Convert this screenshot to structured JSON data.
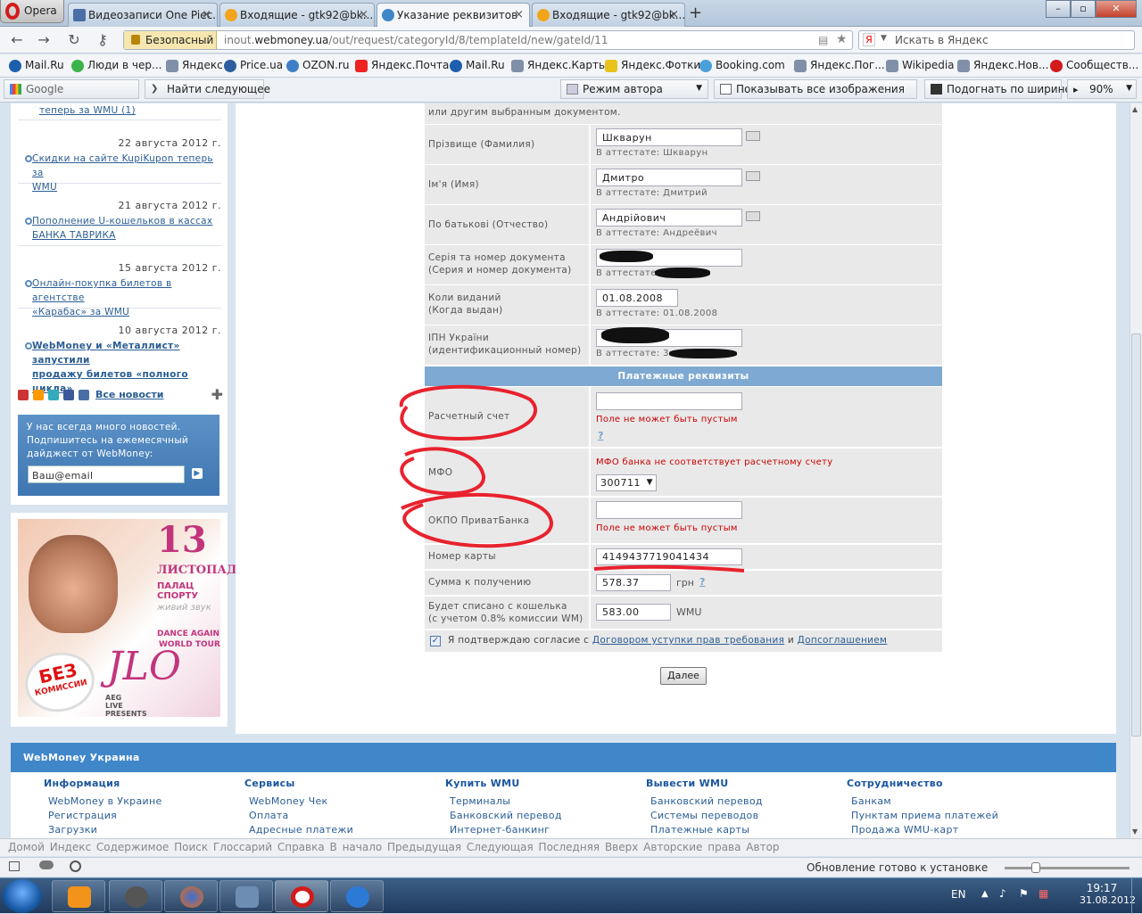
{
  "browser": {
    "menu_label": "Opera",
    "tabs": [
      {
        "label": "Видеозаписи One Piec...",
        "active": false,
        "icon": "vk-icon"
      },
      {
        "label": "Входящие - gtk92@bk....",
        "active": false,
        "icon": "mail-icon"
      },
      {
        "label": "Указание реквизитов",
        "active": true,
        "icon": "globe-icon"
      },
      {
        "label": "Входящие - gtk92@bk....",
        "active": false,
        "icon": "mail-icon"
      }
    ],
    "secure_label": "Безопасный",
    "url_prefix": "inout.",
    "url_domain": "webmoney.ua",
    "url_path": "/out/request/categoryId/8/templateId/new/gateId/11",
    "search_placeholder": "Искать в Яндекс",
    "bookmarks": [
      "Mail.Ru",
      "Люди в чер...",
      "Яндекс",
      "Price.ua",
      "OZON.ru",
      "Яндекс.Почта",
      "Mail.Ru",
      "Яндекс.Карты",
      "Яндекс.Фотки",
      "Booking.com",
      "Яндекс.Пог...",
      "Wikipedia",
      "Яндекс.Нов...",
      "Сообществ..."
    ],
    "google_label": "Google",
    "find_next": "Найти следующее",
    "author_mode": "Режим автора",
    "show_images": "Показывать все изображения",
    "fit_width": "Подогнать по ширине",
    "zoom": "90%"
  },
  "news": {
    "first_link_tail": "теперь за WMU",
    "first_count": "1",
    "items": [
      {
        "date": "22 августа 2012 г.",
        "title_l1": "Скидки на сайте KupiKupon теперь за",
        "title_l2": "WMU"
      },
      {
        "date": "21 августа 2012 г.",
        "title_l1": "Пополнение U-кошельков в кассах",
        "title_l2": "БАНКА ТАВРИКА"
      },
      {
        "date": "15 августа 2012 г.",
        "title_l1": "Онлайн-покупка билетов в агентстве",
        "title_l2": "«Карабас» за WMU"
      },
      {
        "date": "10 августа 2012 г.",
        "title_l1": "WebMoney и «Металлист» запустили",
        "title_l2": "продажу билетов «полного цикла»"
      }
    ],
    "all_news": "Все новости",
    "subscribe_text": [
      "У нас всегда много новостей.",
      "Подпишитесь на ежемесячный",
      "дайджест от WebMoney:"
    ],
    "email_placeholder": "Ваш@email"
  },
  "banner": {
    "day": "13",
    "month": "ЛИСТОПАДА",
    "venue": "ПАЛАЦ СПОРТУ",
    "live": "живий звук",
    "tour1": "DANCE AGAIN",
    "tour2": "WORLD TOUR",
    "stamp1": "БЕЗ",
    "stamp2": "КОМИССИИ",
    "logo": "JLO",
    "presenter": "AEG LIVE PRESENTS"
  },
  "form": {
    "top_note": "или другим выбранным документом.",
    "rows": [
      {
        "label": "Прізвище (Фамилия)",
        "value": "Шкварун",
        "note": "В аттестате: Шкварун"
      },
      {
        "label": "Ім'я (Имя)",
        "value": "Дмитро",
        "note": "В аттестате: Дмитрий"
      },
      {
        "label": "По батькові (Отчество)",
        "value": "Андрійович",
        "note": "В аттестате: Андреёвич"
      }
    ],
    "doc_label1": "Серія та номер документа",
    "doc_label2": "(Серия и номер документа)",
    "doc_note": "В аттестате:",
    "issued_label1": "Коли виданий",
    "issued_label2": "(Когда выдан)",
    "issued_value": "01.08.2008",
    "issued_note": "В аттестате: 01.08.2008",
    "ipn_label1": "ІПН України",
    "ipn_label2": "(идентификационный номер)",
    "ipn_note": "В аттестате: 3",
    "pay_header": "Платежные реквизиты",
    "account_label": "Расчетный счет",
    "account_error": "Поле не может быть пустым",
    "mfo_label": "МФО",
    "mfo_error": "МФО банка не соответствует расчетному счету",
    "mfo_value": "300711",
    "okpo_label": "ОКПО ПриватБанка",
    "okpo_error": "Поле не может быть пустым",
    "card_label": "Номер карты",
    "card_value": "4149437719041434",
    "amount_label": "Сумма к получению",
    "amount_value": "578.37",
    "amount_unit": "грн",
    "debit_label1": "Будет списано с кошелька",
    "debit_label2": "(с учетом 0.8% комиссии WM)",
    "debit_value": "583.00",
    "debit_unit": "WMU",
    "agree_text": "Я подтверждаю согласие с",
    "agree_link1": "Договором уступки прав требования",
    "agree_and": "и",
    "agree_link2": "Допсоглашением",
    "next_button": "Далее"
  },
  "footer": {
    "title": "WebMoney Украина",
    "columns": [
      {
        "head": "Информация",
        "items": [
          "WebMoney в Украине",
          "Регистрация",
          "Загрузки"
        ]
      },
      {
        "head": "Сервисы",
        "items": [
          "WebMoney Чек",
          "Оплата",
          "Адресные платежи"
        ]
      },
      {
        "head": "Купить WMU",
        "items": [
          "Терминалы",
          "Банковский перевод",
          "Интернет-банкинг"
        ]
      },
      {
        "head": "Вывести WMU",
        "items": [
          "Банковский перевод",
          "Системы переводов",
          "Платежные карты"
        ]
      },
      {
        "head": "Сотрудничество",
        "items": [
          "Банкам",
          "Пунктам приема платежей",
          "Продажа WMU-карт"
        ]
      }
    ]
  },
  "nav_bottom": "Домой   Индекс   Содержимое   Поиск   Глоссарий   Справка   В начало   Предыдущая   Следующая   Последняя   Вверх   Авторские права   Автор",
  "status_text": "Обновление готово к установке",
  "tray": {
    "lang": "EN",
    "time": "19:17",
    "date": "31.08.2012"
  },
  "colors": {
    "accent": "#3f87c9",
    "error": "#cc0000",
    "annotation": "#e8222e"
  }
}
